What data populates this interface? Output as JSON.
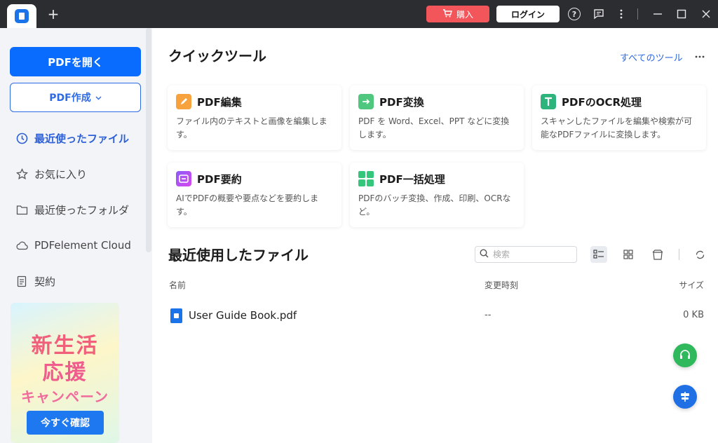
{
  "titlebar": {
    "new_tab_symbol": "+",
    "buy_label": "購入",
    "login_label": "ログイン",
    "help_symbol": "?"
  },
  "sidebar": {
    "open_pdf_label": "PDFを開く",
    "create_pdf_label": "PDF作成",
    "nav": [
      {
        "label": "最近使ったファイル",
        "icon": "clock-icon",
        "active": true
      },
      {
        "label": "お気に入り",
        "icon": "star-icon",
        "active": false
      },
      {
        "label": "最近使ったフォルダ",
        "icon": "folder-icon",
        "active": false
      },
      {
        "label": "PDFelement Cloud",
        "icon": "cloud-icon",
        "active": false
      },
      {
        "label": "契約",
        "icon": "document-icon",
        "active": false
      }
    ],
    "promo": {
      "line1": "新生活",
      "line2": "応援",
      "line3": "キャンペーン",
      "button_label": "今すぐ確認"
    }
  },
  "quick_tools": {
    "title": "クイックツール",
    "all_tools_label": "すべてのツール",
    "cards": [
      {
        "title": "PDF編集",
        "desc": "ファイル内のテキストと画像を編集します。",
        "icon": "edit-pdf-icon"
      },
      {
        "title": "PDF変換",
        "desc": "PDF を Word、Excel、PPT などに変換します。",
        "icon": "convert-pdf-icon"
      },
      {
        "title": "PDFのOCR処理",
        "desc": "スキャンしたファイルを編集や検索が可能なPDFファイルに変換します。",
        "icon": "ocr-icon"
      },
      {
        "title": "PDF要約",
        "desc": "AIでPDFの概要や要点などを要約します。",
        "icon": "summary-icon"
      },
      {
        "title": "PDF一括処理",
        "desc": "PDFのバッチ変換、作成、印刷、OCRなど。",
        "icon": "batch-icon"
      }
    ]
  },
  "recent_files": {
    "title": "最近使用したファイル",
    "search_placeholder": "検索",
    "columns": {
      "name": "名前",
      "modified": "変更時刻",
      "size": "サイズ"
    },
    "rows": [
      {
        "name": "User Guide Book.pdf",
        "modified": "--",
        "size": "0 KB"
      }
    ]
  },
  "colors": {
    "accent": "#0a6cff",
    "titlebar": "#2b2d31",
    "buy": "#f2555a",
    "sidebar_bg": "#f2f4f8"
  }
}
